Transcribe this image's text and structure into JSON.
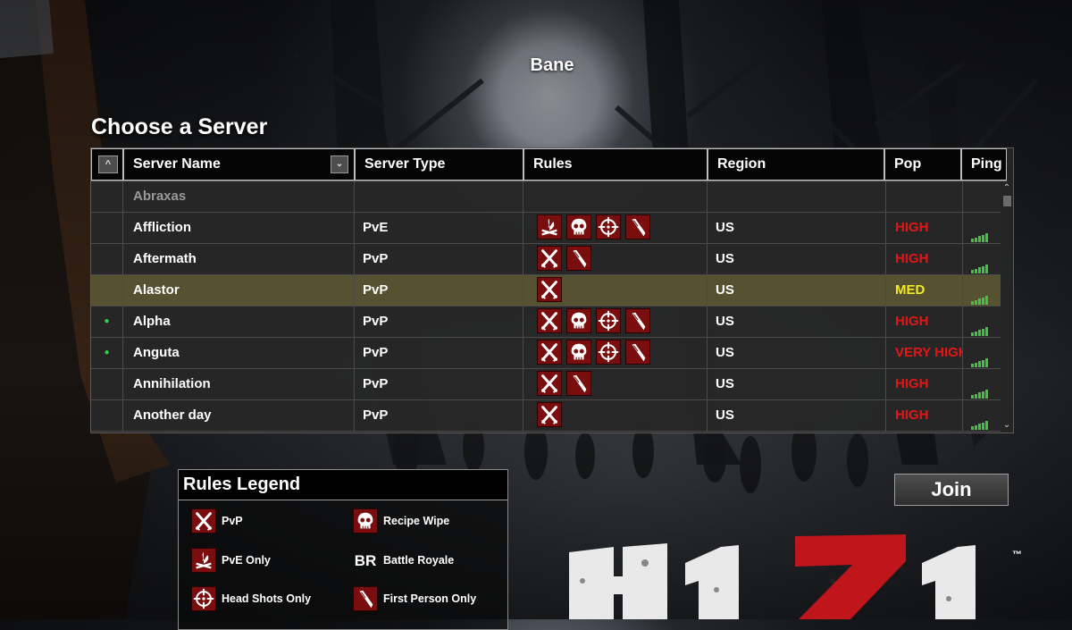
{
  "user": {
    "name": "Bane"
  },
  "page": {
    "title": "Choose a Server"
  },
  "table": {
    "sort_icon": "chevron-up-icon",
    "columns": {
      "name": "Server Name",
      "type": "Server Type",
      "rules": "Rules",
      "region": "Region",
      "pop": "Pop",
      "ping": "Ping"
    },
    "rows": [
      {
        "dot": "",
        "name": "Abraxas",
        "type": "",
        "rules": [],
        "region": "",
        "pop": "",
        "pop_level": "none",
        "ping_bars": 0
      },
      {
        "dot": "",
        "name": "Affliction",
        "type": "PvE",
        "rules": [
          "pve-only",
          "recipe-wipe",
          "head-shots-only",
          "first-person-only"
        ],
        "region": "US",
        "pop": "HIGH",
        "pop_level": "high",
        "ping_bars": 5
      },
      {
        "dot": "",
        "name": "Aftermath",
        "type": "PvP",
        "rules": [
          "pvp",
          "first-person-only"
        ],
        "region": "US",
        "pop": "HIGH",
        "pop_level": "high",
        "ping_bars": 5
      },
      {
        "dot": "",
        "name": "Alastor",
        "type": "PvP",
        "rules": [
          "pvp"
        ],
        "region": "US",
        "pop": "MED",
        "pop_level": "med",
        "ping_bars": 5,
        "selected": true
      },
      {
        "dot": "●",
        "name": "Alpha",
        "type": "PvP",
        "rules": [
          "pvp",
          "recipe-wipe",
          "head-shots-only",
          "first-person-only"
        ],
        "region": "US",
        "pop": "HIGH",
        "pop_level": "high",
        "ping_bars": 5
      },
      {
        "dot": "●",
        "name": "Anguta",
        "type": "PvP",
        "rules": [
          "pvp",
          "recipe-wipe",
          "head-shots-only",
          "first-person-only"
        ],
        "region": "US",
        "pop": "VERY HIGH",
        "pop_level": "high",
        "ping_bars": 5
      },
      {
        "dot": "",
        "name": "Annihilation",
        "type": "PvP",
        "rules": [
          "pvp",
          "first-person-only"
        ],
        "region": "US",
        "pop": "HIGH",
        "pop_level": "high",
        "ping_bars": 5
      },
      {
        "dot": "",
        "name": "Another day",
        "type": "PvP",
        "rules": [
          "pvp"
        ],
        "region": "US",
        "pop": "HIGH",
        "pop_level": "high",
        "ping_bars": 5
      }
    ]
  },
  "legend": {
    "title": "Rules Legend",
    "items": [
      {
        "icon": "pvp",
        "label": "PvP"
      },
      {
        "icon": "recipe-wipe",
        "label": "Recipe Wipe"
      },
      {
        "icon": "pve-only",
        "label": "PvE Only"
      },
      {
        "icon": "battle-royale",
        "label": "Battle Royale",
        "glyph": "BR"
      },
      {
        "icon": "head-shots-only",
        "label": "Head Shots Only"
      },
      {
        "icon": "first-person-only",
        "label": "First Person Only"
      }
    ]
  },
  "actions": {
    "join_label": "Join"
  },
  "logo": {
    "text": "H1Z1",
    "tm": "™"
  },
  "colors": {
    "pop_high": "#e61515",
    "pop_med": "#f5ea22",
    "ping": "#3ec43e",
    "rule_icon_bg": "#7a0d0d",
    "online_dot": "#33d14a"
  }
}
